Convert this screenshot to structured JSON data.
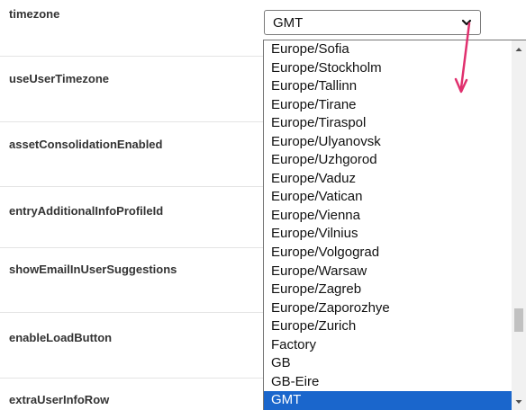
{
  "settings": {
    "rows": [
      {
        "label": "timezone"
      },
      {
        "label": "useUserTimezone"
      },
      {
        "label": "assetConsolidationEnabled"
      },
      {
        "label": "entryAdditionalInfoProfileId"
      },
      {
        "label": "showEmailInUserSuggestions"
      },
      {
        "label": "enableLoadButton"
      },
      {
        "label": "extraUserInfoRow"
      }
    ]
  },
  "timezone_select": {
    "value": "GMT",
    "options": [
      "Europe/Sofia",
      "Europe/Stockholm",
      "Europe/Tallinn",
      "Europe/Tirane",
      "Europe/Tiraspol",
      "Europe/Ulyanovsk",
      "Europe/Uzhgorod",
      "Europe/Vaduz",
      "Europe/Vatican",
      "Europe/Vienna",
      "Europe/Vilnius",
      "Europe/Volgograd",
      "Europe/Warsaw",
      "Europe/Zagreb",
      "Europe/Zaporozhye",
      "Europe/Zurich",
      "Factory",
      "GB",
      "GB-Eire",
      "GMT"
    ],
    "selected_option": "GMT"
  },
  "colors": {
    "selected_bg": "#1a66cc",
    "annotation_arrow": "#e0306e"
  },
  "icons": {
    "select_chevron": "chevron-down-icon",
    "scroll_up": "triangle-up-icon",
    "scroll_down": "triangle-down-icon",
    "annotation": "arrow-down-icon"
  }
}
